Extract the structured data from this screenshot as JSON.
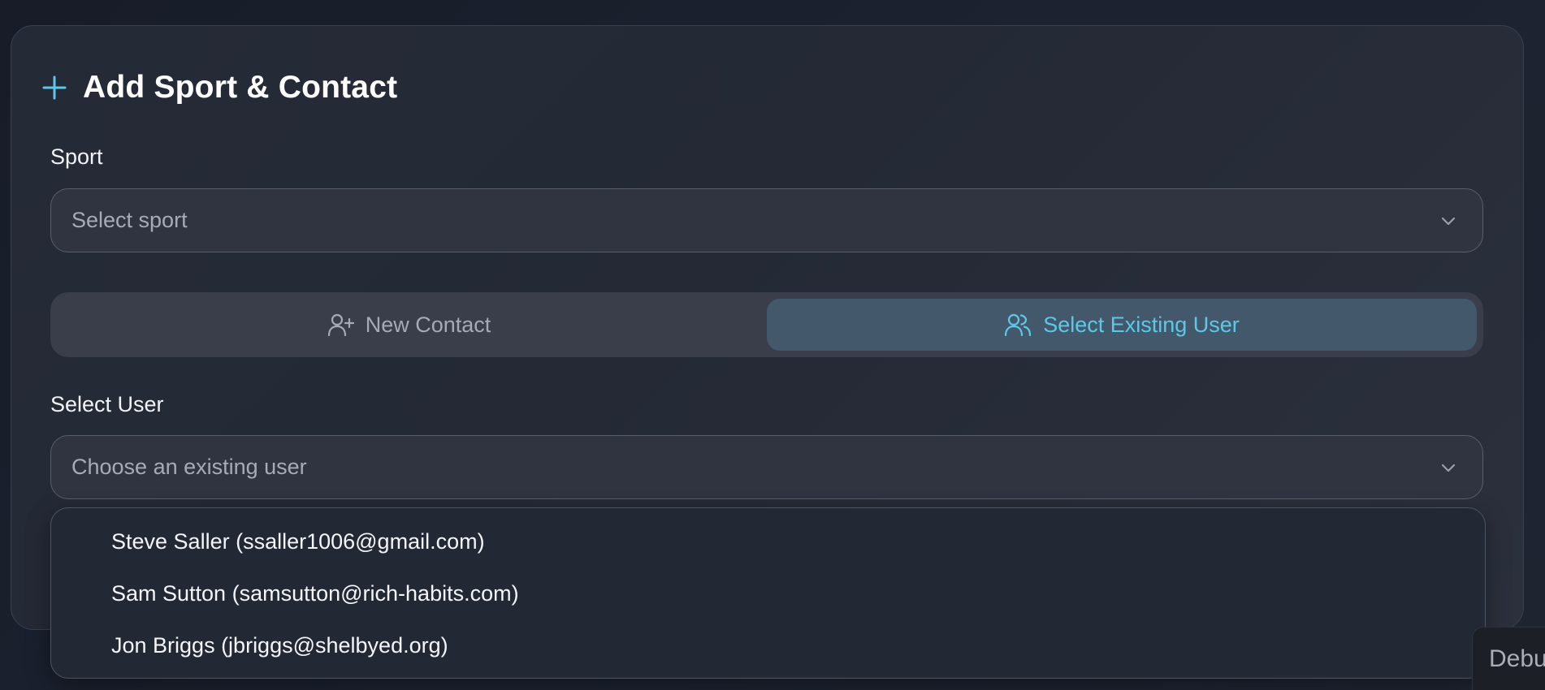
{
  "card": {
    "title": "Add Sport & Contact",
    "accent_color": "#5cc8e8"
  },
  "sport": {
    "label": "Sport",
    "placeholder": "Select sport"
  },
  "contact_toggle": {
    "new_contact_label": "New Contact",
    "select_existing_label": "Select Existing User",
    "active": "select_existing"
  },
  "select_user": {
    "label": "Select User",
    "placeholder": "Choose an existing user",
    "options": [
      "Steve Saller (ssaller1006@gmail.com)",
      "Sam Sutton (samsutton@rich-habits.com)",
      "Jon Briggs (jbriggs@shelbyed.org)"
    ]
  },
  "debug": {
    "label": "Debu"
  },
  "icons": {
    "header": "plus-icon",
    "new_contact": "user-plus-icon",
    "select_existing": "users-icon",
    "dropdown": "chevron-down-icon"
  }
}
